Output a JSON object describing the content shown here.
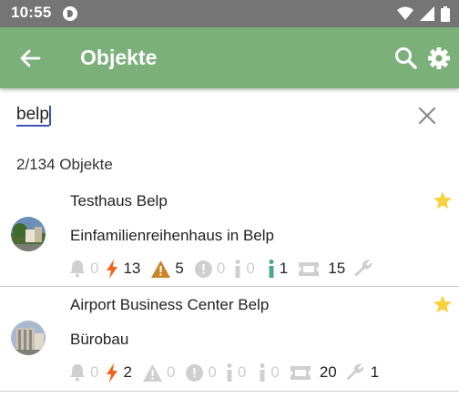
{
  "status_bar": {
    "time": "10:55"
  },
  "app_bar": {
    "title": "Objekte"
  },
  "search": {
    "query": "belp"
  },
  "result_count": "2/134 Objekte",
  "items": [
    {
      "name": "Testhaus Belp",
      "type": "Einfamilienreihenhaus in Belp",
      "favorite": true,
      "stats": {
        "alarm": "0",
        "fault": "13",
        "warning": "5",
        "error": "0",
        "info": "0",
        "info_active": "1",
        "tickets": "15",
        "service": ""
      }
    },
    {
      "name": "Airport Business Center Belp",
      "type": "Bürobau",
      "favorite": true,
      "stats": {
        "alarm": "0",
        "fault": "2",
        "warning": "0",
        "error": "0",
        "info": "0",
        "info_active": "0",
        "tickets": "20",
        "service": "1"
      }
    }
  ],
  "colors": {
    "app_bar": "#7cb07a",
    "status_bar": "#757575",
    "star": "#f7d23c",
    "fault": "#f0641e",
    "warning": "#c9862a",
    "info_active": "#4aa98a",
    "icon_inactive": "#cfcfcf"
  }
}
